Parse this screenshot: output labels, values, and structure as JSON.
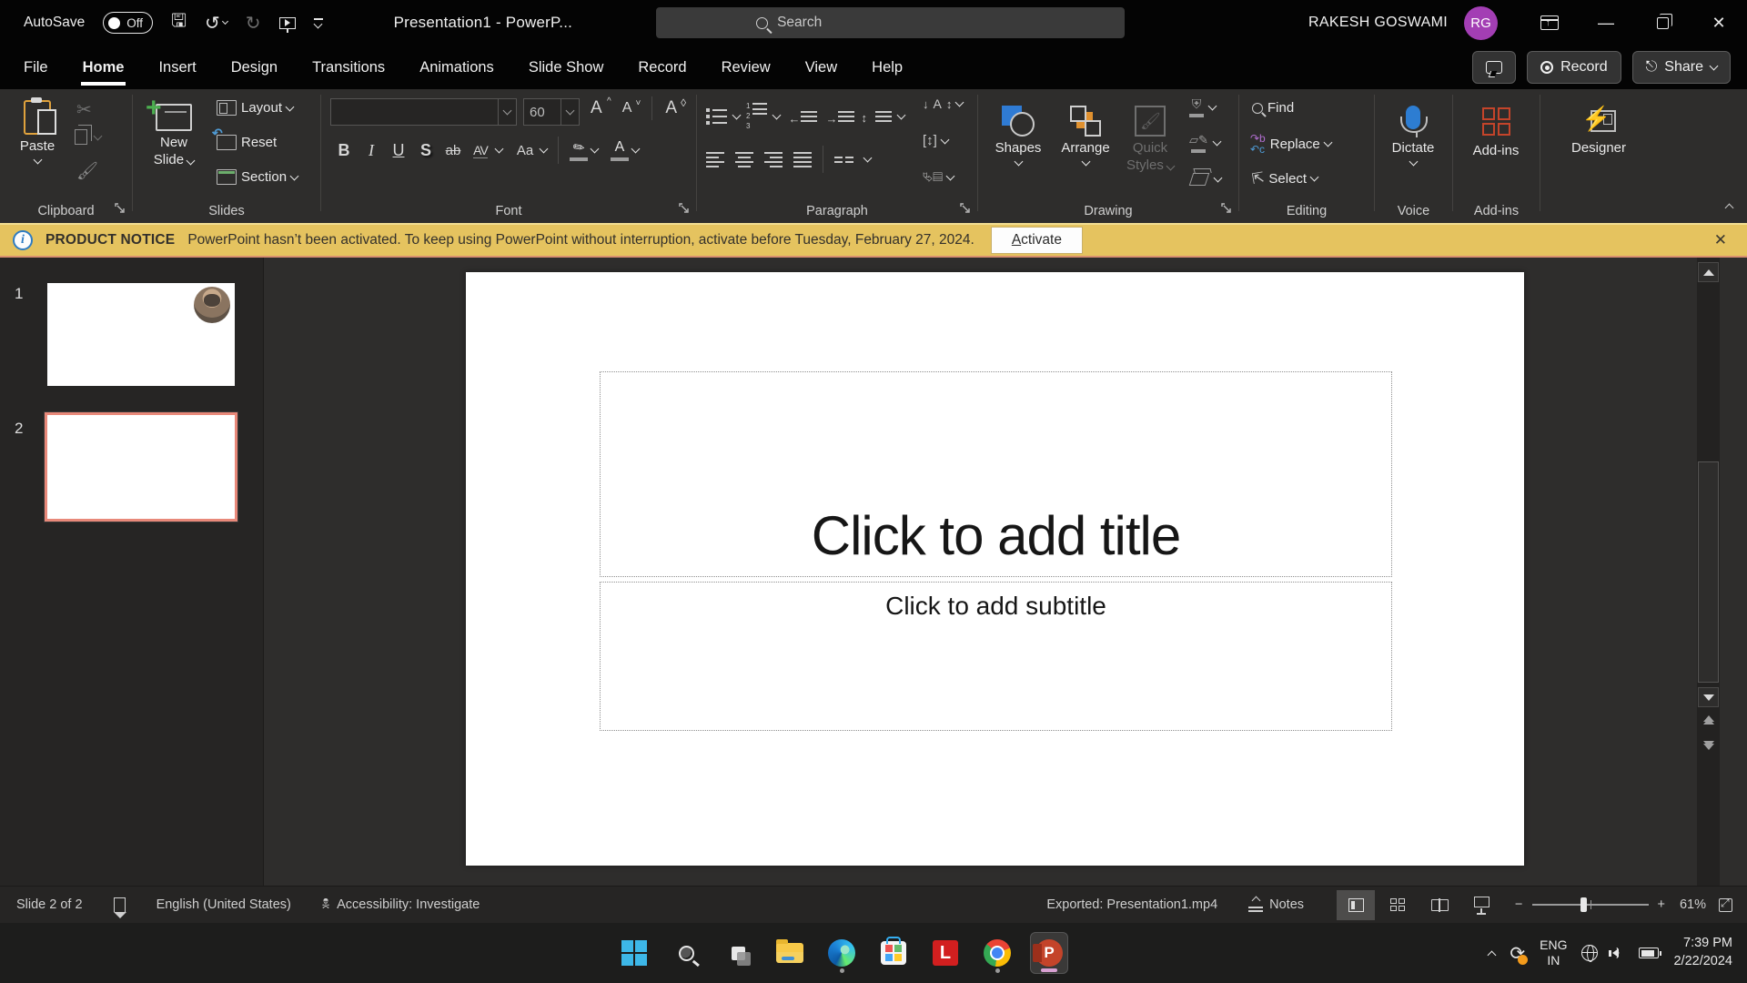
{
  "titlebar": {
    "autosave_label": "AutoSave",
    "autosave_state": "Off",
    "doc_title": "Presentation1  -  PowerP...",
    "search_placeholder": "Search",
    "user_name": "RAKESH GOSWAMI",
    "user_initials": "RG"
  },
  "tabs": {
    "items": [
      "File",
      "Home",
      "Insert",
      "Design",
      "Transitions",
      "Animations",
      "Slide Show",
      "Record",
      "Review",
      "View",
      "Help"
    ],
    "active": "Home",
    "record_button": "Record",
    "share_button": "Share"
  },
  "ribbon": {
    "clipboard": {
      "paste": "Paste",
      "group_label": "Clipboard"
    },
    "slides": {
      "new_slide_line1": "New",
      "new_slide_line2": "Slide",
      "layout": "Layout",
      "reset": "Reset",
      "section": "Section",
      "group_label": "Slides"
    },
    "font": {
      "size_value": "60",
      "bold": "B",
      "italic": "I",
      "underline": "U",
      "shadow": "S",
      "strikethrough": "ab",
      "spacing": "AV",
      "case": "Aa",
      "group_label": "Font"
    },
    "paragraph": {
      "group_label": "Paragraph"
    },
    "drawing": {
      "shapes": "Shapes",
      "arrange": "Arrange",
      "quick_styles_line1": "Quick",
      "quick_styles_line2": "Styles",
      "group_label": "Drawing"
    },
    "editing": {
      "find": "Find",
      "replace": "Replace",
      "select": "Select",
      "group_label": "Editing"
    },
    "voice": {
      "dictate": "Dictate",
      "group_label": "Voice"
    },
    "addins": {
      "button": "Add-ins",
      "group_label": "Add-ins"
    },
    "designer": {
      "button": "Designer"
    }
  },
  "notice": {
    "badge": "PRODUCT NOTICE",
    "message": "PowerPoint hasn’t been activated. To keep using PowerPoint without interruption, activate before Tuesday, February 27, 2024.",
    "activate_button": "Activate"
  },
  "slide_panel": {
    "slide1_number": "1",
    "slide2_number": "2"
  },
  "canvas": {
    "title_placeholder": "Click to add title",
    "subtitle_placeholder": "Click to add subtitle"
  },
  "statusbar": {
    "slide_indicator": "Slide 2 of 2",
    "language": "English (United States)",
    "accessibility": "Accessibility: Investigate",
    "exported": "Exported: Presentation1.mp4",
    "notes_label": "Notes",
    "zoom_level": "61%"
  },
  "taskbar": {
    "lang_line1": "ENG",
    "lang_line2": "IN",
    "time": "7:39 PM",
    "date": "2/22/2024"
  },
  "colors": {
    "selection_salmon": "#e8897a",
    "notice_yellow": "#e5c35f",
    "avatar_purple": "#a33eb4",
    "powerpoint_orange": "#c4442a",
    "dictate_blue": "#2d7dd2",
    "designer_gold": "#f0a300",
    "active_tab_underline": "#ffffff"
  }
}
